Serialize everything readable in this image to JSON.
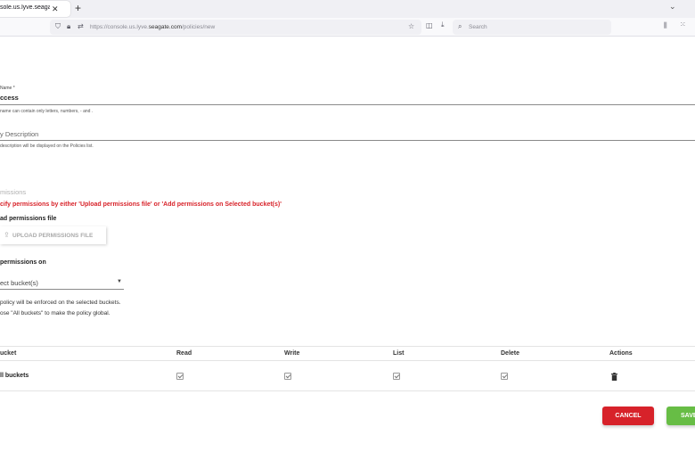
{
  "browser": {
    "tab_title": "sole.us.lyve.seagate.com/po",
    "tab_close": "✕",
    "new_tab": "+",
    "url_prefix": "https://console.us.lyve.",
    "url_domain": "seagate.com",
    "url_suffix": "/policies/new",
    "search_placeholder": "Search"
  },
  "form": {
    "name_label": "Name *",
    "name_value": "ccess",
    "name_hint": "name can contain only letters, numbers, - and .",
    "description_placeholder": "y Description",
    "description_hint": "description will be displayed on the Policies list.",
    "permissions_heading": "missions",
    "permissions_error": "cify permissions by either 'Upload permissions file' or 'Add permissions on Selected bucket(s)'",
    "upload_label": "ad permissions file",
    "upload_button": "UPLOAD PERMISSIONS FILE",
    "add_on_label": "permissions on",
    "bucket_select_value": "ect bucket(s)",
    "info_line1": "policy will be enforced on the selected buckets.",
    "info_line2": "ose \"All buckets\" to make the policy global."
  },
  "table": {
    "headers": [
      "ucket",
      "Read",
      "Write",
      "List",
      "Delete",
      "Actions"
    ],
    "rows": [
      {
        "bucket": "ll buckets",
        "read": true,
        "write": true,
        "list": true,
        "delete": true
      }
    ]
  },
  "actions": {
    "cancel": "CANCEL",
    "save": "SAVE"
  },
  "colors": {
    "error": "#d8232a",
    "cancel": "#d7222a",
    "save": "#67bd45"
  }
}
